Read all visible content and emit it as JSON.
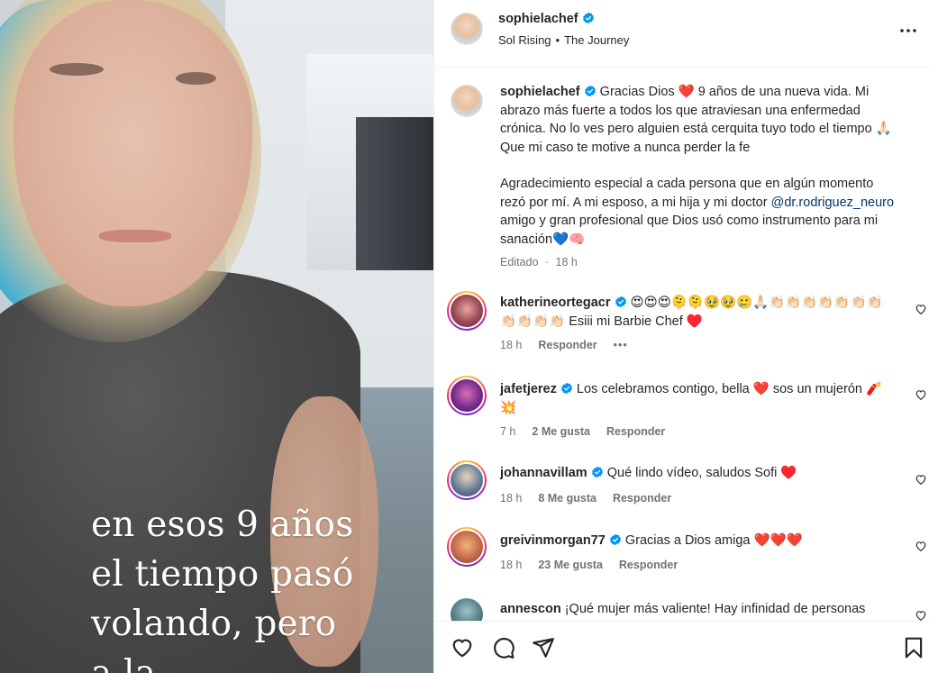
{
  "media": {
    "caption_lines": [
      "en esos 9 años",
      "el tiempo pasó",
      "volando, pero",
      "a la"
    ]
  },
  "header": {
    "username": "sophielachef",
    "audio_title": "Sol Rising",
    "audio_separator": "•",
    "audio_artist": "The Journey"
  },
  "post": {
    "username": "sophielachef",
    "caption_part1": "Gracias Dios ❤️ 9 años de una nueva vida. Mi abrazo más fuerte a todos los que atraviesan una enfermedad crónica. No lo ves pero alguien está cerquita tuyo todo el tiempo 🙏🏻 Que mi caso te motive a nunca perder la fe",
    "caption_part2_a": "Agradecimiento especial a cada persona que en algún momento rezó por mí. A mi esposo, a mi hija y mi doctor ",
    "mention": "@dr.rodriguez_neuro",
    "caption_part2_b": " amigo y gran profesional que Dios usó como instrumento para mi sanación💙🧠",
    "edited_label": "Editado",
    "edited_dot": "·",
    "time": "18 h"
  },
  "comments": [
    {
      "username": "katherineortegacr",
      "text": "😍😍😍🫠🫠🥹🥹🥲🙏🏻👏🏻👏🏻👏🏻👏🏻👏🏻👏🏻👏🏻👏🏻👏🏻👏🏻👏🏻 Esiii mi Barbie Chef ♥️",
      "time": "18 h",
      "likes": "",
      "reply": "Responder",
      "more": "•••"
    },
    {
      "username": "jafetjerez",
      "text": "Los celebramos contigo, bella ❤️ sos un mujerón 🧨💥",
      "time": "7 h",
      "likes": "2 Me gusta",
      "reply": "Responder"
    },
    {
      "username": "johannavillam",
      "text": "Qué lindo vídeo, saludos Sofi ♥️",
      "time": "18 h",
      "likes": "8 Me gusta",
      "reply": "Responder"
    },
    {
      "username": "greivinmorgan77",
      "text": "Gracias a Dios amiga ❤️❤️❤️",
      "time": "18 h",
      "likes": "23 Me gusta",
      "reply": "Responder"
    },
    {
      "username": "annescon",
      "text": "¡Qué mujer más valiente! Hay infinidad de personas"
    }
  ],
  "icons": {
    "verified": "verified-badge-icon",
    "more": "more-options-icon",
    "like": "heart-icon",
    "comment": "comment-icon",
    "share": "share-icon",
    "save": "bookmark-icon"
  },
  "colors": {
    "verified": "#0095f6",
    "text": "#262626",
    "secondary": "#737373",
    "mention": "#00376b"
  }
}
